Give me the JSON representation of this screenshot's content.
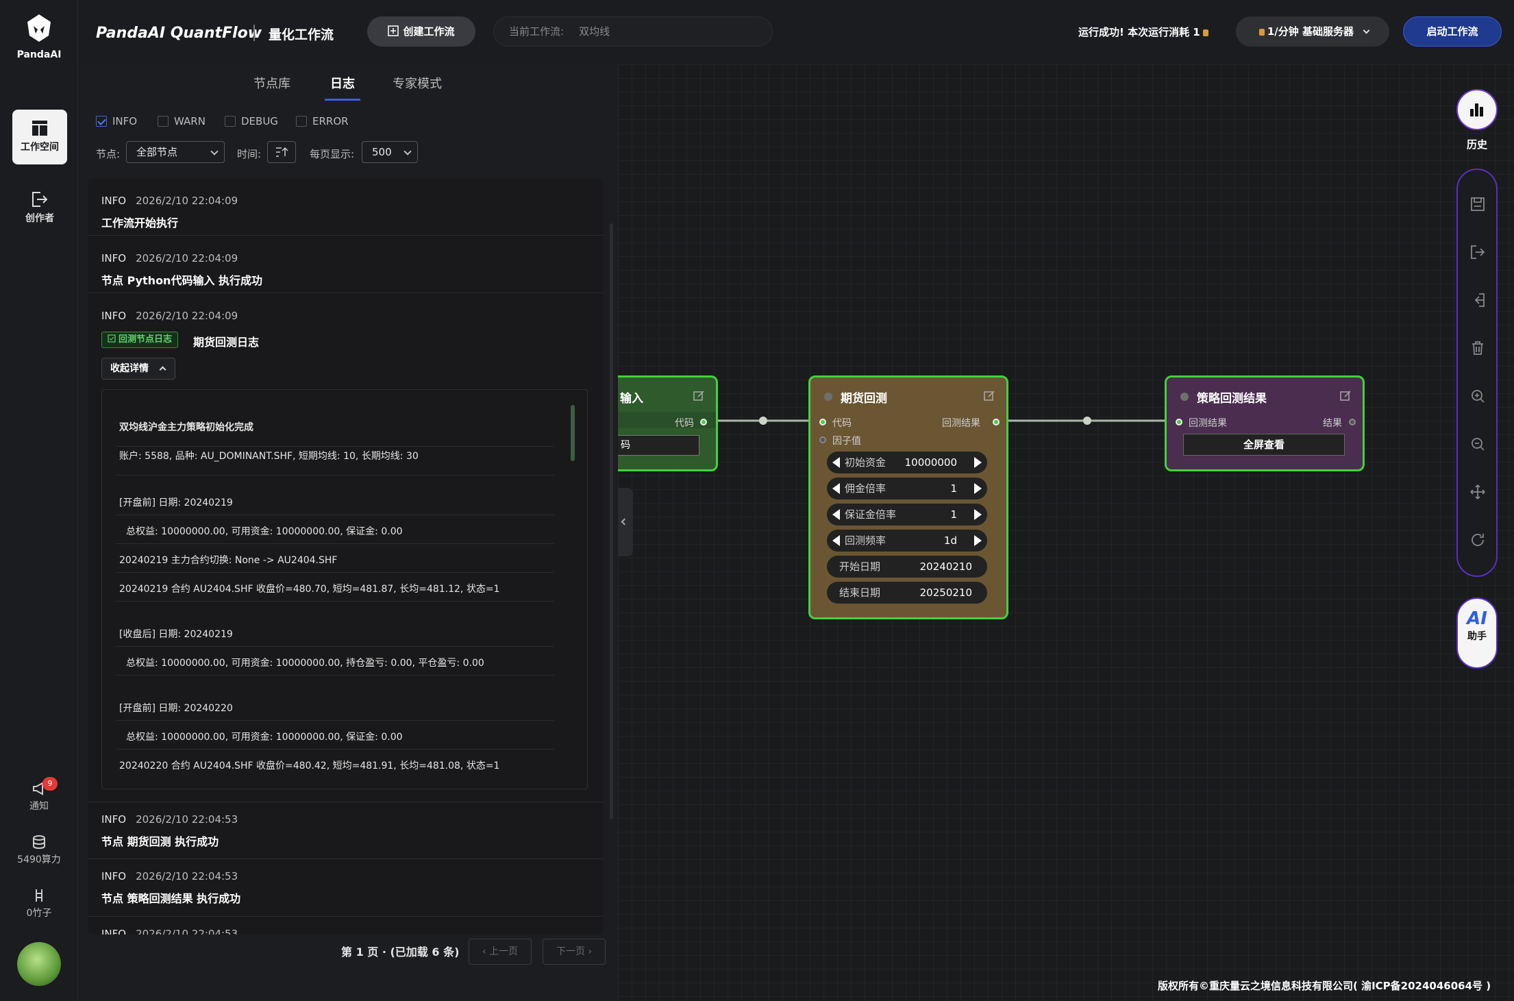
{
  "rail": {
    "logo_text": "PandaAI",
    "workspace_label": "工作空间",
    "creator_label": "创作者",
    "notify_label": "通知",
    "notify_badge": "9",
    "power_label": "5490算力",
    "bamboo_label": "0竹子"
  },
  "header": {
    "brand": "PandaAI QuantFlow",
    "brand_sub": "量化工作流",
    "create_button": "创建工作流",
    "current_wf_label": "当前工作流:",
    "current_wf_value": "双均线",
    "run_status": "运行成功!  本次运行消耗 1",
    "server_button": "1/分钟  基础服务器",
    "start_button": "启动工作流"
  },
  "panel": {
    "tabs": [
      "节点库",
      "日志",
      "专家模式"
    ],
    "active_tab": "日志",
    "levels": [
      {
        "label": "INFO",
        "checked": true
      },
      {
        "label": "WARN",
        "checked": false
      },
      {
        "label": "DEBUG",
        "checked": false
      },
      {
        "label": "ERROR",
        "checked": false
      }
    ],
    "node_filter_label": "节点:",
    "node_filter_value": "全部节点",
    "time_label": "时间:",
    "page_size_label": "每页显示:",
    "page_size_value": "500",
    "logs": [
      {
        "level": "INFO",
        "time": "2026/2/10 22:04:09",
        "message": "工作流开始执行"
      },
      {
        "level": "INFO",
        "time": "2026/2/10 22:04:09",
        "message": "节点 Python代码输入 执行成功"
      },
      {
        "level": "INFO",
        "time": "2026/2/10 22:04:09",
        "tag": "回测节点日志",
        "message": "期货回测日志",
        "collapse_label": "收起详情"
      },
      {
        "level": "INFO",
        "time": "2026/2/10 22:04:53",
        "message": "节点 期货回测 执行成功"
      },
      {
        "level": "INFO",
        "time": "2026/2/10 22:04:53",
        "message": "节点 策略回测结果 执行成功"
      },
      {
        "level": "INFO",
        "time": "2026/2/10 22:04:53",
        "message": ""
      }
    ],
    "detail_lines": [
      "双均线沪金主力策略初始化完成",
      "账户: 5588, 品种: AU_DOMINANT.SHF, 短期均线: 10, 长期均线: 30",
      "[开盘前] 日期: 20240219",
      "总权益: 10000000.00, 可用资金: 10000000.00, 保证金: 0.00",
      "20240219 主力合约切换: None -> AU2404.SHF",
      "20240219 合约 AU2404.SHF 收盘价=480.70, 短均=481.87, 长均=481.12, 状态=1",
      "[收盘后] 日期: 20240219",
      "总权益: 10000000.00, 可用资金: 10000000.00, 持仓盈亏: 0.00, 平仓盈亏: 0.00",
      "[开盘前] 日期: 20240220",
      "总权益: 10000000.00, 可用资金: 10000000.00, 保证金: 0.00",
      "20240220 合约 AU2404.SHF 收盘价=480.42, 短均=481.91, 长均=481.08, 状态=1"
    ],
    "pager_text": "第 1 页 · (已加载 6 条)",
    "prev_button": "上一页",
    "next_button": "下一页"
  },
  "nodes": {
    "input_node": {
      "title": "输入",
      "out_port": "代码",
      "field": "码"
    },
    "backtest": {
      "title": "期货回测",
      "in_ports": [
        "代码",
        "因子值"
      ],
      "out_port": "回测结果",
      "params": [
        {
          "label": "初始资金",
          "value": "10000000"
        },
        {
          "label": "佣金倍率",
          "value": "1"
        },
        {
          "label": "保证金倍率",
          "value": "1"
        },
        {
          "label": "回测频率",
          "value": "1d"
        }
      ],
      "dates": [
        {
          "label": "开始日期",
          "value": "20240210"
        },
        {
          "label": "结束日期",
          "value": "20250210"
        }
      ]
    },
    "result": {
      "title": "策略回测结果",
      "in_port": "回测结果",
      "out_port": "结果",
      "button": "全屏查看"
    }
  },
  "right_tools": {
    "history_label": "历史",
    "ai_label": "AI",
    "ai_sub": "助手"
  },
  "footer": {
    "copyright": "版权所有©重庆量云之境信息科技有限公司( 渝ICP备2024046064号 )"
  },
  "colors": {
    "accent_green": "#42d23b",
    "accent_blue": "#1f3a8f",
    "accent_purple": "#5a2fc0",
    "backtest_node": "#6b5633",
    "result_node": "#4a2d4f",
    "input_node": "#2f5a2c"
  }
}
